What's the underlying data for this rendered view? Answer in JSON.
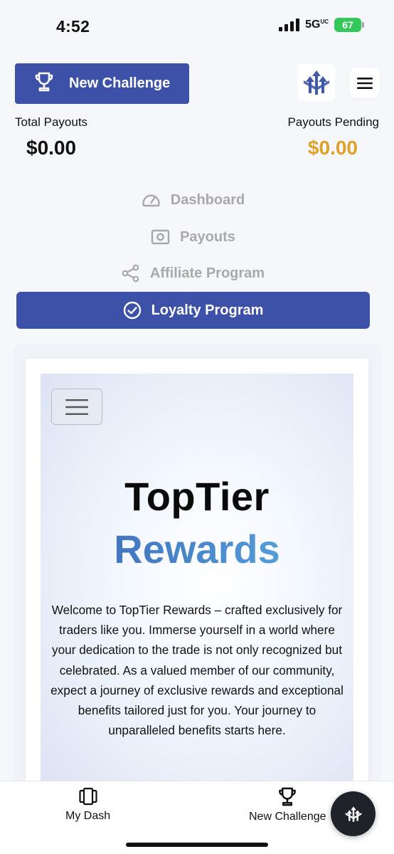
{
  "status_bar": {
    "time": "4:52",
    "network": "5G",
    "network_sup": "UC",
    "battery": "67"
  },
  "header": {
    "new_challenge_label": "New Challenge"
  },
  "stats": {
    "total_payouts_label": "Total Payouts",
    "total_payouts_value": "$0.00",
    "payouts_pending_label": "Payouts Pending",
    "payouts_pending_value": "$0.00"
  },
  "nav": {
    "items": [
      {
        "label": "Dashboard",
        "icon": "speedometer-icon",
        "active": false
      },
      {
        "label": "Payouts",
        "icon": "cash-icon",
        "active": false
      },
      {
        "label": "Affiliate Program",
        "icon": "share-icon",
        "active": false
      },
      {
        "label": "Loyalty Program",
        "icon": "check-circle-icon",
        "active": true
      }
    ]
  },
  "hero": {
    "title_line1": "TopTier",
    "title_line2": "Rewards",
    "body": "Welcome to TopTier Rewards – crafted exclusively for traders like you. Immerse yourself in a world where your dedication to the trade is not only recognized but celebrated. As a valued member of our community, expect a journey of exclusive rewards and exceptional benefits tailored just for you. Your journey to unparalleled benefits starts here."
  },
  "tabbar": {
    "my_dash_label": "My Dash",
    "new_challenge_label": "New Challenge"
  },
  "colors": {
    "primary": "#3d51a8",
    "pending": "#e0a12b",
    "battery": "#34c759"
  }
}
